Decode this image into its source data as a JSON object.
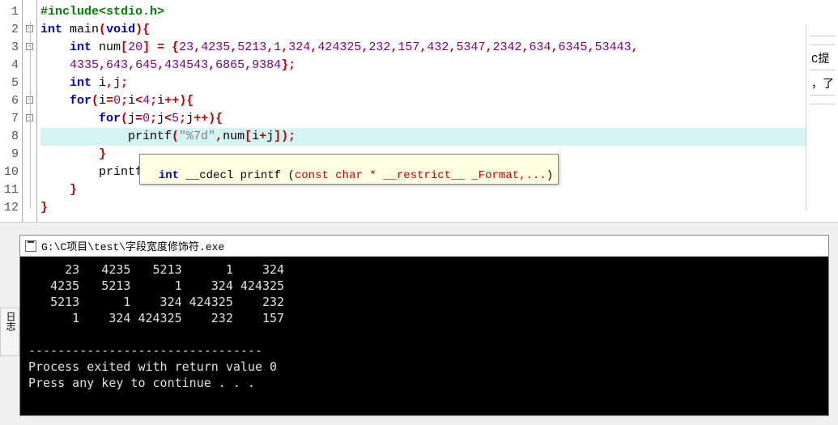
{
  "editor": {
    "lines": [
      {
        "n": 1,
        "fold": "",
        "html": "<span class='prep'>#include</span><span class='prep'>&lt;stdio.h&gt;</span>"
      },
      {
        "n": 2,
        "fold": "box",
        "html": "<span class='kw'>int</span> <span class='fname'>main</span><span class='brace'>(</span><span class='kw'>void</span><span class='brace'>){</span>"
      },
      {
        "n": 3,
        "fold": "box",
        "html": "    <span class='kw'>int</span> num<span class='brace'>[</span><span class='num'>20</span><span class='brace'>]</span> <span class='brace'>=</span> <span class='brace'>{</span><span class='num'>23</span><span class='brace'>,</span><span class='num'>4235</span><span class='brace'>,</span><span class='num'>5213</span><span class='brace'>,</span><span class='num'>1</span><span class='brace'>,</span><span class='num'>324</span><span class='brace'>,</span><span class='num'>424325</span><span class='brace'>,</span><span class='num'>232</span><span class='brace'>,</span><span class='num'>157</span><span class='brace'>,</span><span class='num'>432</span><span class='brace'>,</span><span class='num'>5347</span><span class='brace'>,</span><span class='num'>2342</span><span class='brace'>,</span><span class='num'>634</span><span class='brace'>,</span><span class='num'>6345</span><span class='brace'>,</span><span class='num'>53443</span><span class='brace'>,</span>"
      },
      {
        "n": 4,
        "fold": "line",
        "html": "    <span class='num'>4335</span><span class='brace'>,</span><span class='num'>643</span><span class='brace'>,</span><span class='num'>645</span><span class='brace'>,</span><span class='num'>434543</span><span class='brace'>,</span><span class='num'>6865</span><span class='brace'>,</span><span class='num'>9384</span><span class='brace'>};</span>"
      },
      {
        "n": 5,
        "fold": "line",
        "html": "    <span class='kw'>int</span> i<span class='brace'>,</span>j<span class='brace'>;</span>"
      },
      {
        "n": 6,
        "fold": "box",
        "html": "    <span class='kw'>for</span><span class='brace'>(</span>i<span class='brace'>=</span><span class='num'>0</span><span class='brace'>;</span>i<span class='brace'>&lt;</span><span class='num'>4</span><span class='brace'>;</span>i<span class='brace'>++){</span>"
      },
      {
        "n": 7,
        "fold": "box",
        "html": "        <span class='kw'>for</span><span class='brace'>(</span>j<span class='brace'>=</span><span class='num'>0</span><span class='brace'>;</span>j<span class='brace'>&lt;</span><span class='num'>5</span><span class='brace'>;</span>j<span class='brace'>++){</span>"
      },
      {
        "n": 8,
        "fold": "line",
        "hl": true,
        "html": "            printf<span class='brace'>(</span><span class='str'>\"%7d\"</span><span class='brace'>,</span>num<span class='brace'>[</span>i<span class='brace'>+</span>j<span class='brace'>]);</span>"
      },
      {
        "n": 9,
        "fold": "line",
        "html": "        <span class='brace'>}</span>"
      },
      {
        "n": 10,
        "fold": "line",
        "html": "        printf<span class='brace'>(</span><span class='str'>\"\\n\"</span><span class='brace'>);</span>"
      },
      {
        "n": 11,
        "fold": "line",
        "html": "    <span class='brace'>}</span>"
      },
      {
        "n": 12,
        "fold": "end",
        "html": "<span class='brace'>}</span>"
      }
    ]
  },
  "tooltip": {
    "text_parts": {
      "p1": "int",
      "p2": " __cdecl ",
      "p3": "printf ",
      "p4": "(",
      "p5": "const char * __restrict__ _Format,...",
      "p6": ")"
    }
  },
  "sidebar": {
    "items": [
      "",
      "",
      "C提",
      "，了",
      ""
    ]
  },
  "left_tab": {
    "label": "日志"
  },
  "console": {
    "title": "G:\\C项目\\test\\字段宽度修饰符.exe",
    "rows": [
      "     23   4235   5213      1    324",
      "   4235   5213      1    324 424325",
      "   5213      1    324 424325    232",
      "      1    324 424325    232    157"
    ],
    "divider": "--------------------------------",
    "exit_line": "Process exited with return value 0",
    "prompt_line": "Press any key to continue . . ."
  }
}
